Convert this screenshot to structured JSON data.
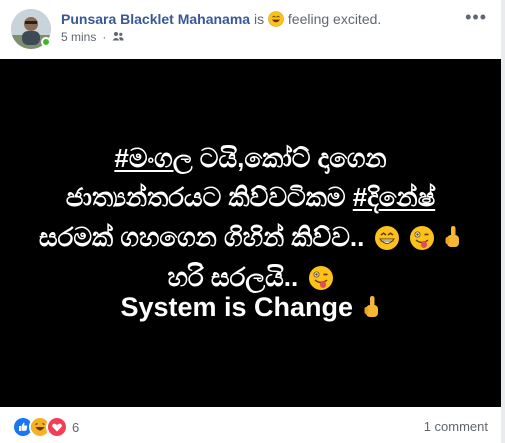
{
  "post": {
    "author": "Punsara Blacklet Mahanama",
    "is_text": "is",
    "feeling_text": "feeling excited.",
    "time": "5 mins",
    "privacy_icon": "friends-icon",
    "more_icon": "more-dots-icon"
  },
  "image_text": {
    "line1_tag": "#මංගල",
    "line1_rest": " ටයි,කෝට් දාගෙන",
    "line2_a": "ජාත්‍යන්තරයට කිව්වටිකම ",
    "line2_tag": "#දිනේෂ්",
    "line3": "සරමක් ගහගෙන ගිහින් කිව්ව..",
    "line4": "හරි සරලයි..",
    "line5": "System is Change"
  },
  "footer": {
    "reaction_icons": [
      "like-icon",
      "haha-icon",
      "love-icon"
    ],
    "reaction_count": "6",
    "comment_count": "1 comment"
  },
  "colors": {
    "author": "#385898",
    "image_bg": "#000000",
    "like": "#1877f2",
    "love": "#f33e58",
    "haha": "#f7b125"
  }
}
